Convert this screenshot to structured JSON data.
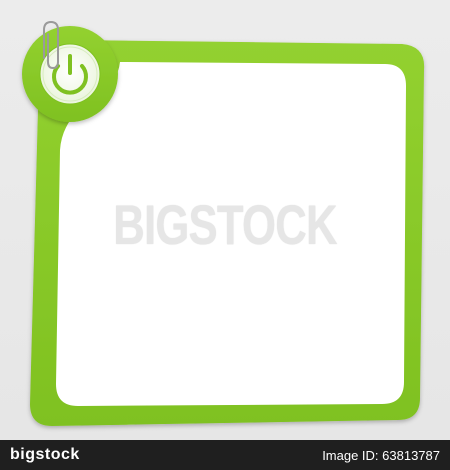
{
  "watermark": {
    "text": "BIGSTOCK"
  },
  "footer": {
    "logo_text": "bigstock",
    "image_id": "Image ID: 63813787"
  },
  "icons": {
    "badge": "power-icon",
    "clip": "paper-clip-icon"
  },
  "colors": {
    "frame_green": "#8ccb2a",
    "frame_green_dark": "#6fae18",
    "panel_white": "#ffffff",
    "background": "#ececec",
    "footer_bg": "#1f1f1f"
  }
}
